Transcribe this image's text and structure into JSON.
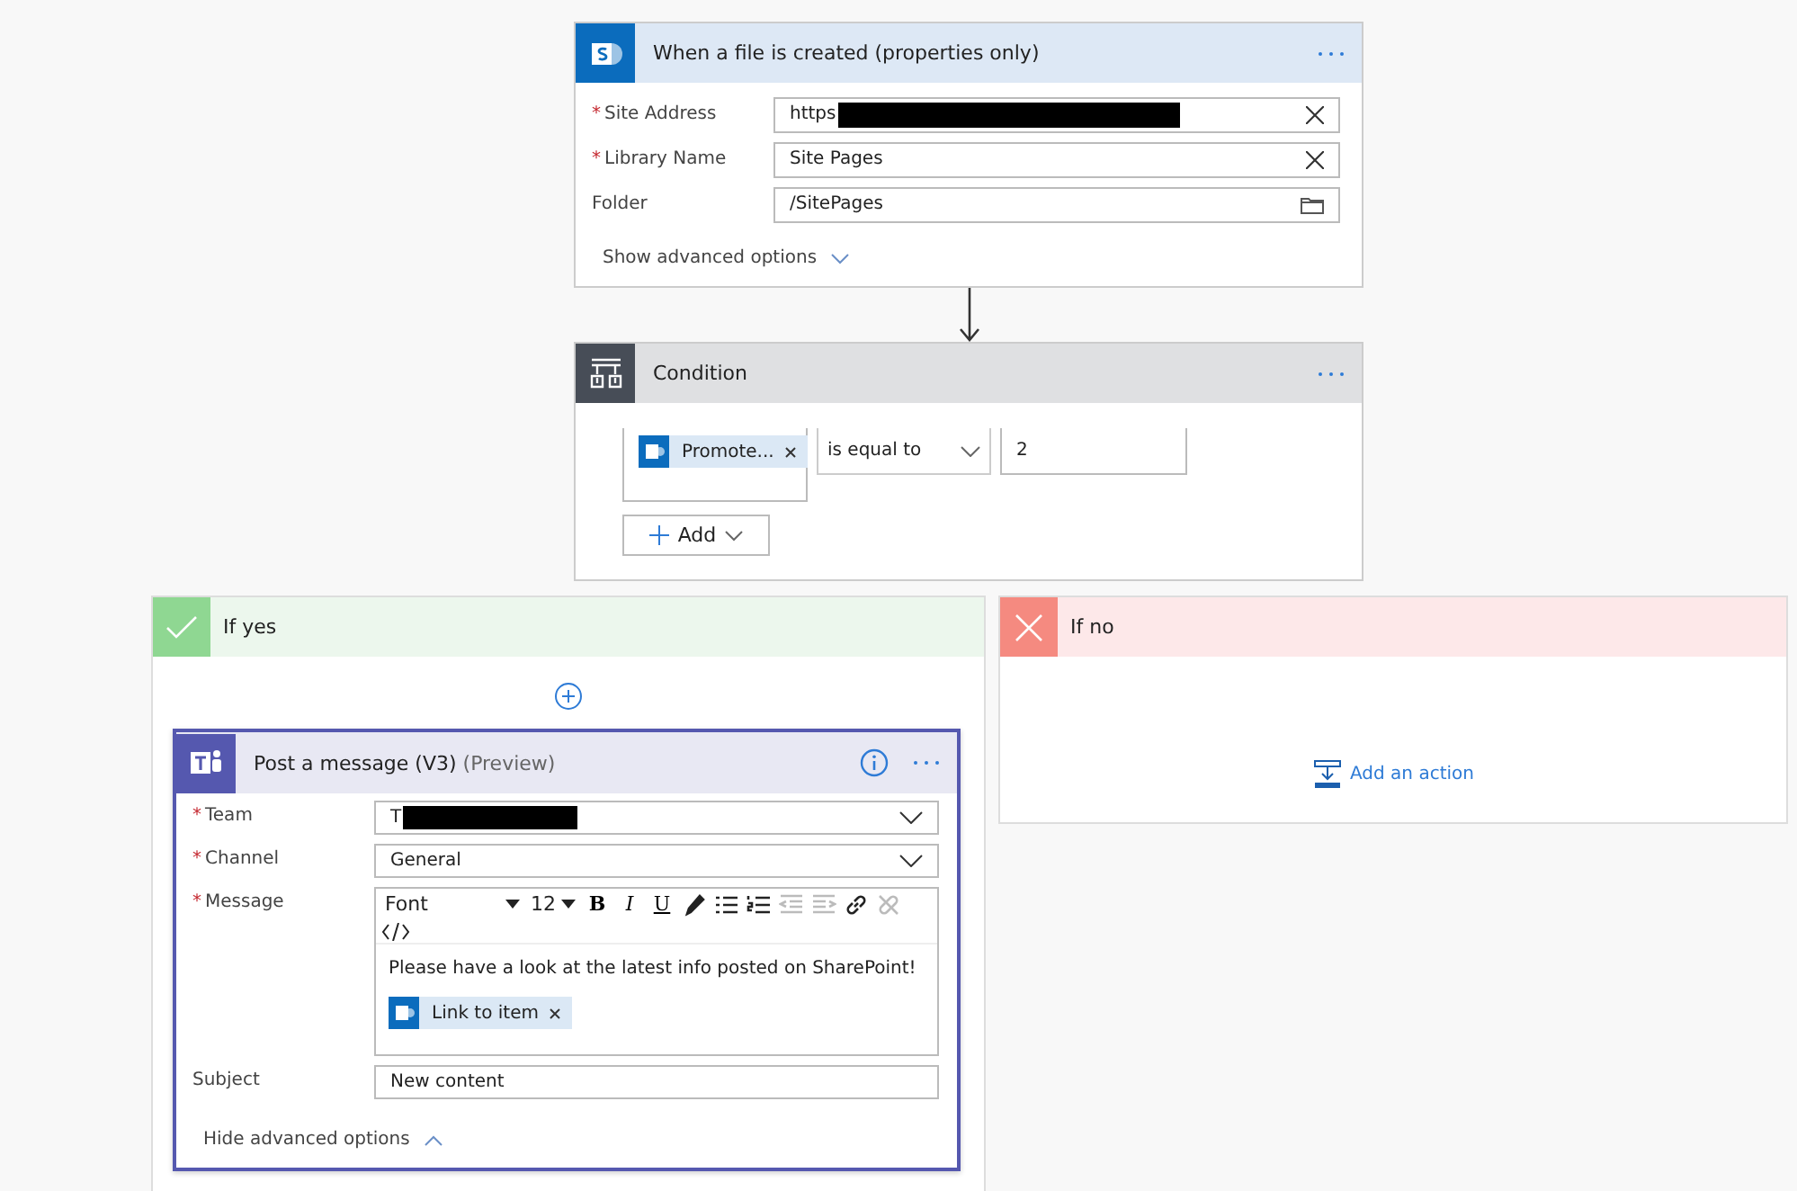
{
  "trigger": {
    "title": "When a file is created (properties only)",
    "fields": [
      {
        "label": "Site Address",
        "required_mark": "*",
        "value": "https",
        "redacted": true,
        "kind": "clear"
      },
      {
        "label": "Library Name",
        "required_mark": "*",
        "value": "Site Pages",
        "redacted": false,
        "kind": "clear"
      },
      {
        "label": "Folder",
        "value": "/SitePages",
        "redacted": false,
        "kind": "folder"
      }
    ],
    "advanced_link": "Show advanced options"
  },
  "condition": {
    "title": "Condition",
    "token": "Promote...",
    "operator": "is equal to",
    "value": "2",
    "add_button": "Add"
  },
  "branches": [
    {
      "kind": "yes",
      "title": "If yes"
    },
    {
      "kind": "no",
      "title": "If no",
      "add_action": "Add an action"
    }
  ],
  "action": {
    "title": "Post a message (V3)",
    "subtitle": "(Preview)",
    "fields": [
      {
        "kind": "dropdown",
        "label": "Team",
        "required_mark": "*",
        "value": "T",
        "redacted": true
      },
      {
        "kind": "dropdown",
        "label": "Channel",
        "required_mark": "*",
        "value": "General",
        "redacted": false
      },
      {
        "kind": "editor",
        "label": "Message",
        "required_mark": "*"
      },
      {
        "kind": "text",
        "label": "Subject",
        "value": "New content",
        "redacted": false
      }
    ],
    "editor": {
      "font": "Font",
      "size": "12",
      "format_buttons": [
        {
          "kind": "bold",
          "label": "B"
        },
        {
          "kind": "italic",
          "label": "I"
        },
        {
          "kind": "underline",
          "label": "U"
        }
      ],
      "icon_buttons": [
        {
          "kind": "pen",
          "disabled": false
        },
        {
          "kind": "bullets",
          "disabled": false
        },
        {
          "kind": "numbers",
          "disabled": false
        },
        {
          "kind": "outdent",
          "disabled": true
        },
        {
          "kind": "indent",
          "disabled": true
        },
        {
          "kind": "link",
          "disabled": false
        },
        {
          "kind": "unlink",
          "disabled": true
        }
      ],
      "body": "Please have a look at the latest info posted on SharePoint!",
      "token": "Link to item"
    },
    "advanced_link": "Hide advanced options"
  }
}
